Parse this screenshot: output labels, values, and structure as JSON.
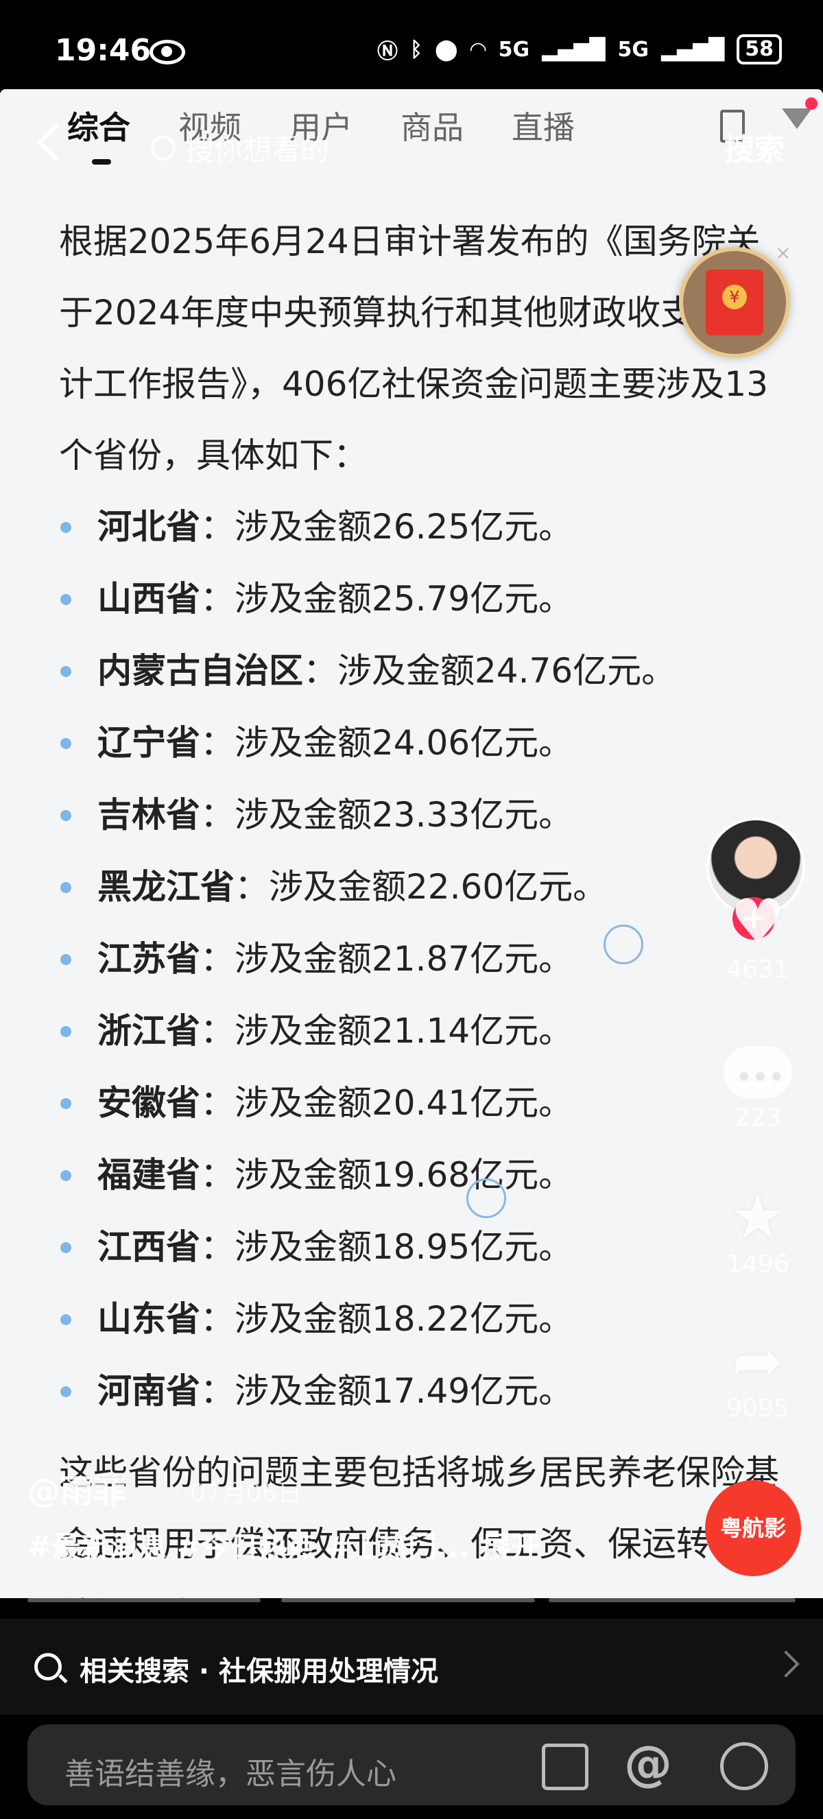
{
  "status_bar": {
    "time": "19:46",
    "signal_labels": [
      "5G",
      "5G"
    ],
    "battery": "58"
  },
  "header": {
    "tabs": [
      "综合",
      "视频",
      "用户",
      "商品",
      "直播"
    ],
    "active_tab": "综合",
    "search_placeholder": "搜你想看的",
    "search_button": "搜索"
  },
  "article": {
    "intro": "根据2025年6月24日审计署发布的《国务院关于2024年度中央预算执行和其他财政收支的审计工作报告》，406亿社保资金问题主要涉及13个省份，具体如下：",
    "items": [
      {
        "province": "河北省",
        "detail": "：涉及金额26.25亿元。"
      },
      {
        "province": "山西省",
        "detail": "：涉及金额25.79亿元。"
      },
      {
        "province": "内蒙古自治区",
        "detail": "：涉及金额24.76亿元。"
      },
      {
        "province": "辽宁省",
        "detail": "：涉及金额24.06亿元。"
      },
      {
        "province": "吉林省",
        "detail": "：涉及金额23.33亿元。"
      },
      {
        "province": "黑龙江省",
        "detail": "：涉及金额22.60亿元。"
      },
      {
        "province": "江苏省",
        "detail": "：涉及金额21.87亿元。"
      },
      {
        "province": "浙江省",
        "detail": "：涉及金额21.14亿元。"
      },
      {
        "province": "安徽省",
        "detail": "：涉及金额20.41亿元。"
      },
      {
        "province": "福建省",
        "detail": "：涉及金额19.68亿元。"
      },
      {
        "province": "江西省",
        "detail": "：涉及金额18.95亿元。"
      },
      {
        "province": "山东省",
        "detail": "：涉及金额18.22亿元。"
      },
      {
        "province": "河南省",
        "detail": "：涉及金额17.49亿元。"
      }
    ],
    "tail": "这些省份的问题主要包括将城乡居民养老保险基金违规用于偿还政府债务、保工资、保运转等非社保用途。"
  },
  "actions": {
    "likes": "4631",
    "comments": "223",
    "favorites": "1496",
    "shares": "9095",
    "music_label": "粤航影"
  },
  "caption": {
    "author": "@雨菲",
    "date": "· 07月06日",
    "hashtags": "#最新消息 #今日热点 #上热门...",
    "expand": "展开"
  },
  "related_search": "相关搜索 · 社保挪用处理情况",
  "comment_bar": {
    "placeholder": "善语结善缘，恶言伤人心"
  }
}
